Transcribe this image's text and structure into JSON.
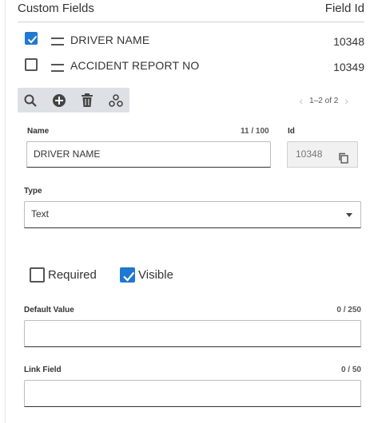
{
  "header": {
    "title": "Custom Fields",
    "id_column": "Field Id"
  },
  "rows": [
    {
      "label": "DRIVER NAME",
      "id": "10348",
      "checked": true
    },
    {
      "label": "ACCIDENT REPORT NO",
      "id": "10349",
      "checked": false
    }
  ],
  "toolbar": {
    "icons": [
      "search-icon",
      "add-circle-icon",
      "delete-icon",
      "hierarchy-icon"
    ],
    "pager_text": "1–2 of 2"
  },
  "form": {
    "name": {
      "label": "Name",
      "count": "11 / 100",
      "value": "DRIVER NAME"
    },
    "id": {
      "label": "Id",
      "value": "10348"
    },
    "type": {
      "label": "Type",
      "value": "Text"
    },
    "required": {
      "label": "Required",
      "checked": false
    },
    "visible": {
      "label": "Visible",
      "checked": true
    },
    "default_value": {
      "label": "Default Value",
      "count": "0 / 250",
      "value": ""
    },
    "link_field": {
      "label": "Link Field",
      "count": "0 / 50",
      "value": ""
    }
  },
  "colors": {
    "accent": "#1f78d1",
    "toolbar_bg": "#dde1e6"
  }
}
